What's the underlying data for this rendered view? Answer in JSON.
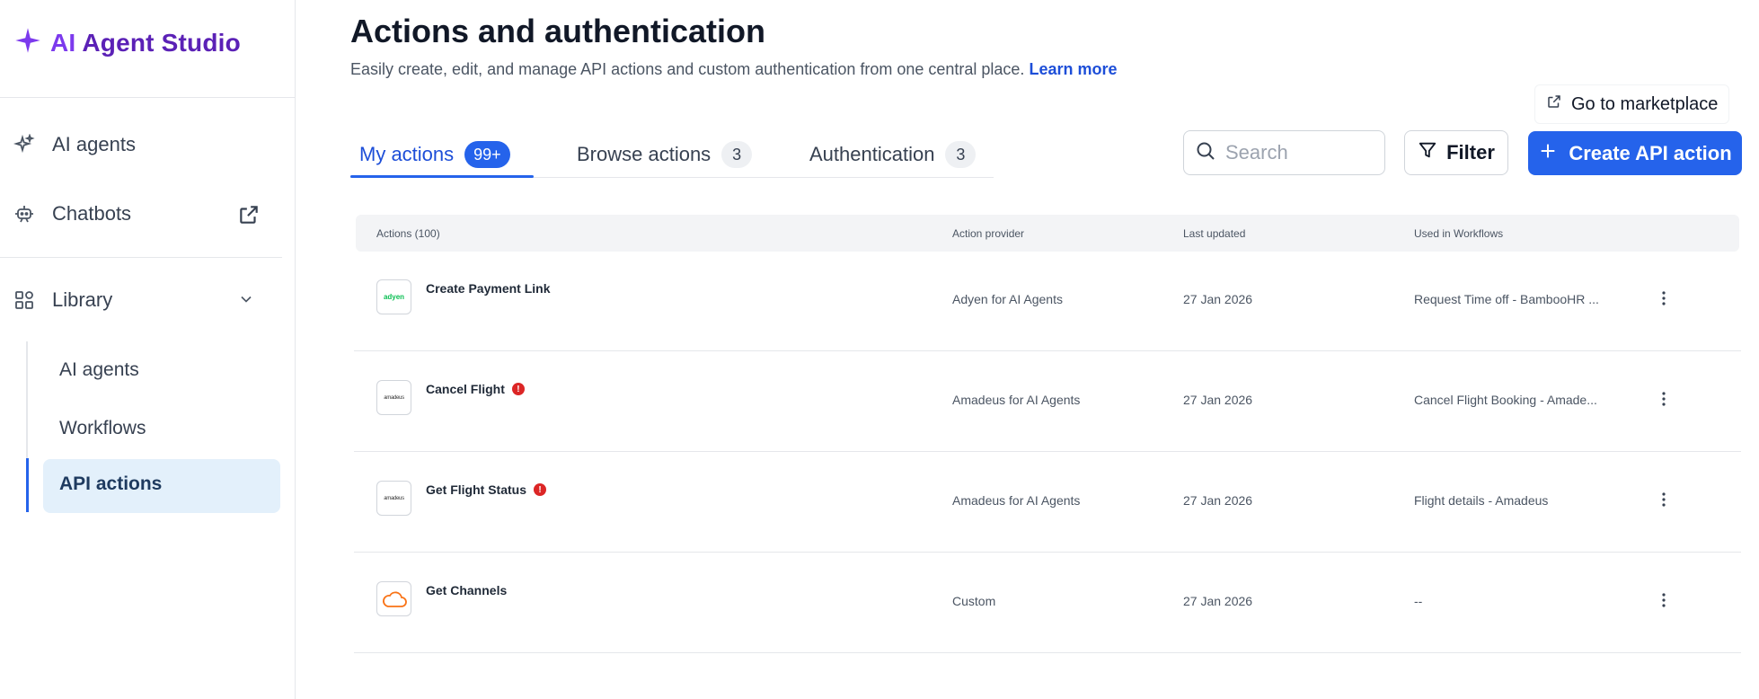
{
  "brand": {
    "ai": "AI",
    "rest": " Agent Studio"
  },
  "sidebar": {
    "items": [
      {
        "label": "AI agents"
      },
      {
        "label": "Chatbots"
      },
      {
        "label": "Library"
      }
    ],
    "library_items": [
      {
        "label": "AI agents"
      },
      {
        "label": "Workflows"
      },
      {
        "label": "API actions",
        "active": true
      }
    ]
  },
  "header": {
    "title": "Actions and authentication",
    "subtitle": "Easily create, edit, and manage API actions and custom authentication from one central place.",
    "learn_more": "Learn more",
    "marketplace": "Go to marketplace"
  },
  "tabs": [
    {
      "label": "My actions",
      "badge": "99+",
      "active": true
    },
    {
      "label": "Browse actions",
      "badge": "3"
    },
    {
      "label": "Authentication",
      "badge": "3"
    }
  ],
  "toolbar": {
    "search_placeholder": "Search",
    "filter_label": "Filter",
    "create_label": "Create API action"
  },
  "table": {
    "columns": [
      "Actions (100)",
      "Action provider",
      "Last updated",
      "Used in Workflows"
    ],
    "rows": [
      {
        "logo": "adyen",
        "name": "Create Payment Link",
        "warning": false,
        "provider": "Adyen for AI Agents",
        "updated": "27 Jan 2026",
        "workflows": "Request Time off - BambooHR ..."
      },
      {
        "logo": "amadeus",
        "name": "Cancel Flight",
        "warning": true,
        "provider": "Amadeus for AI Agents",
        "updated": "27 Jan 2026",
        "workflows": "Cancel Flight Booking - Amade..."
      },
      {
        "logo": "amadeus",
        "name": "Get Flight Status",
        "warning": true,
        "provider": "Amadeus for AI Agents",
        "updated": "27 Jan 2026",
        "workflows": "Flight details - Amadeus"
      },
      {
        "logo": "",
        "name": "Get Channels",
        "warning": false,
        "provider": "Custom",
        "updated": "27 Jan 2026",
        "workflows": "--"
      }
    ]
  },
  "colors": {
    "accent": "#2563eb",
    "brand": "#7c3aed",
    "warning": "#dc2626",
    "adyen_green": "#0abf53",
    "cloud_orange": "#f97316"
  },
  "icons": [
    "sparkle-logo-icon",
    "sparkle-icon",
    "chatbot-icon",
    "external-link-icon",
    "library-icon",
    "chevron-down-icon",
    "edit-external-icon",
    "search-icon",
    "filter-icon",
    "plus-icon",
    "kebab-icon",
    "warning-icon",
    "cloud-icon"
  ]
}
